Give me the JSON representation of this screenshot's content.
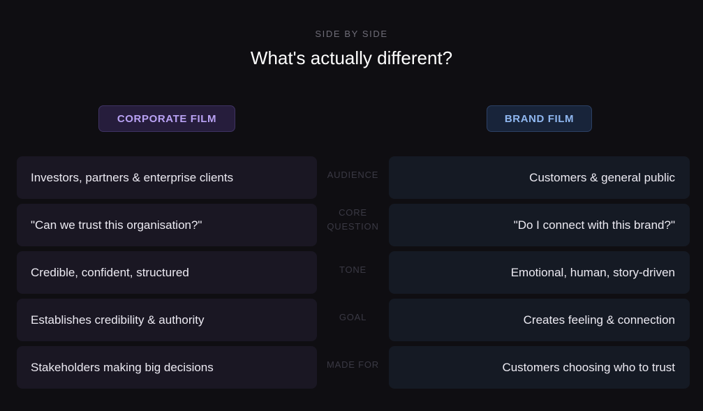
{
  "header": {
    "eyebrow": "SIDE BY SIDE",
    "title": "What's actually different?"
  },
  "columns": {
    "left_badge": "CORPORATE FILM",
    "right_badge": "BRAND FILM"
  },
  "colors": {
    "background": "#0f0e12",
    "corporate_accent": "#b9a2f4",
    "brand_accent": "#8fb7f0"
  },
  "rows": [
    {
      "label": "AUDIENCE",
      "corporate": "Investors, partners & enterprise clients",
      "brand": "Customers & general public"
    },
    {
      "label": "CORE\nQUESTION",
      "corporate": "\"Can we trust this organisation?\"",
      "brand": "\"Do I connect with this brand?\""
    },
    {
      "label": "TONE",
      "corporate": "Credible, confident, structured",
      "brand": "Emotional, human, story-driven"
    },
    {
      "label": "GOAL",
      "corporate": "Establishes credibility & authority",
      "brand": "Creates feeling & connection"
    },
    {
      "label": "MADE FOR",
      "corporate": "Stakeholders making big decisions",
      "brand": "Customers choosing who to trust"
    }
  ]
}
